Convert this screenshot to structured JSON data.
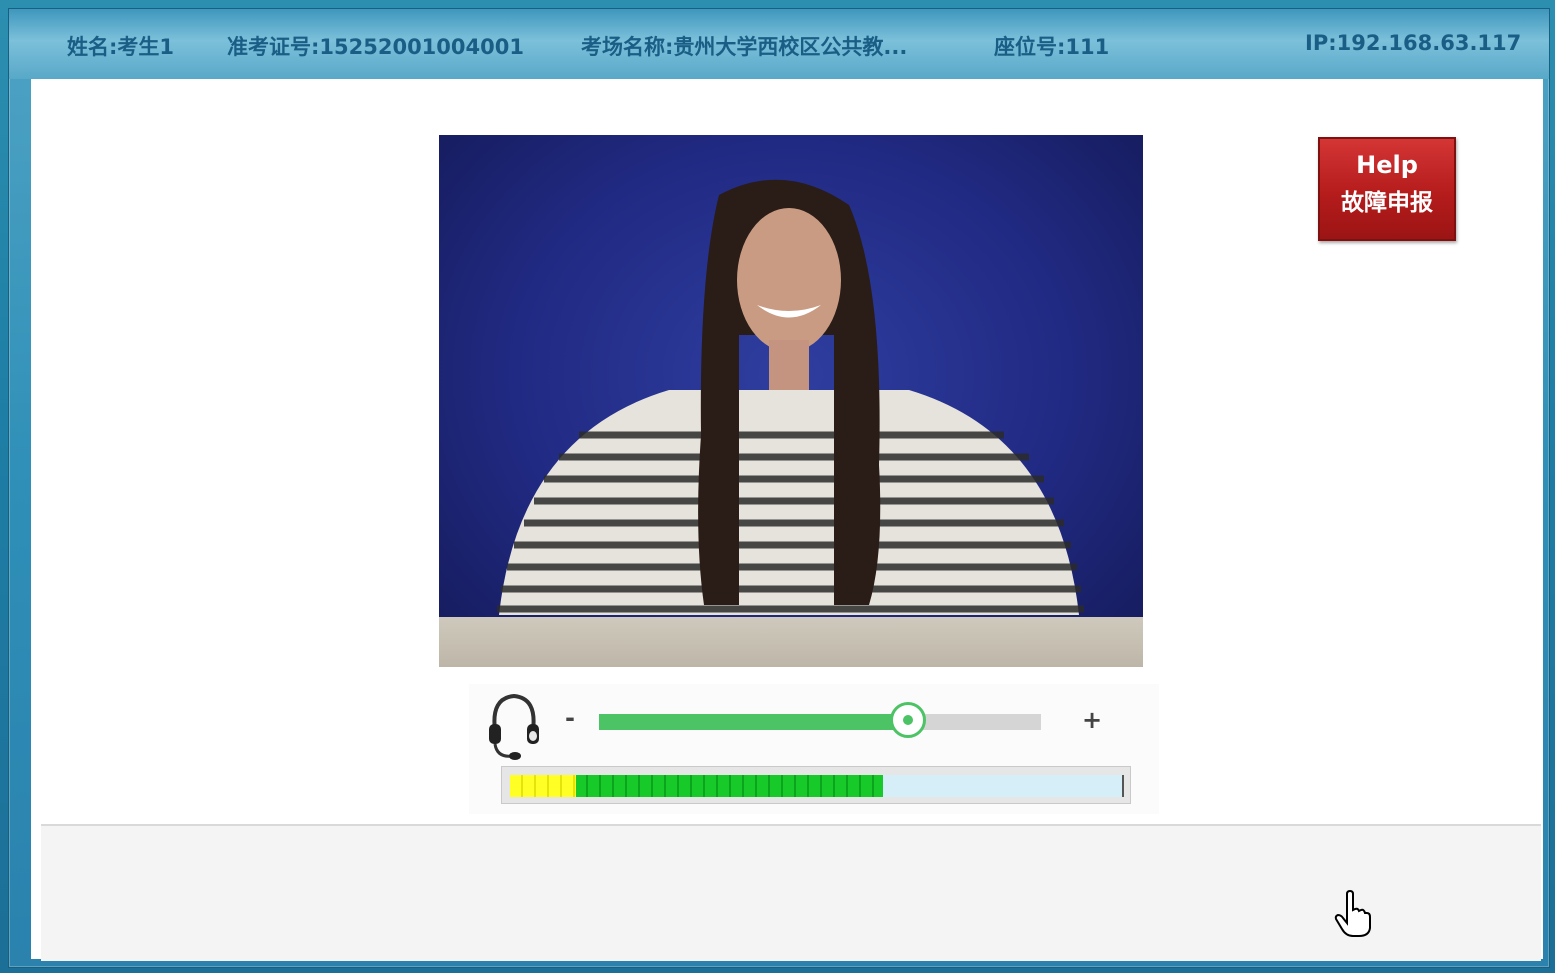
{
  "header": {
    "name": "姓名:考生1",
    "ticket": "准考证号:15252001004001",
    "venue": "考场名称:贵州大学西校区公共教...",
    "seat": "座位号:111",
    "ip": "IP:192.168.63.117"
  },
  "help_button": {
    "label_en": "Help",
    "label_cn": "故障申报"
  },
  "audio": {
    "minus_label": "-",
    "plus_label": "+",
    "volume_level": 0.7,
    "mic_level": 0.61
  },
  "colors": {
    "accent_green": "#4cc364",
    "help_red": "#c02424",
    "header_text": "#1a5e86"
  },
  "icons": [
    "headset-icon",
    "hand-cursor-icon"
  ]
}
